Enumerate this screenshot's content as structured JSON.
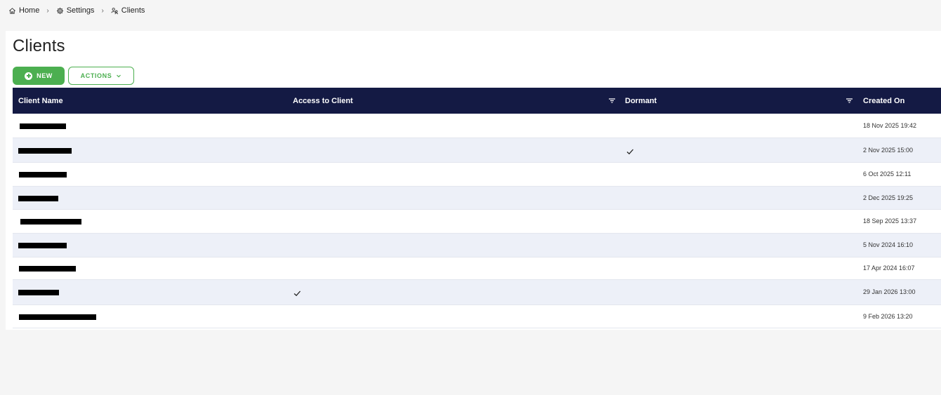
{
  "breadcrumb": {
    "items": [
      {
        "label": "Home",
        "icon": "home-icon"
      },
      {
        "label": "Settings",
        "icon": "gear-icon"
      },
      {
        "label": "Clients",
        "icon": "users-icon"
      }
    ],
    "separator": "›"
  },
  "page": {
    "title": "Clients"
  },
  "toolbar": {
    "new_label": "NEW",
    "new_icon": "plus-circle-icon",
    "actions_label": "ACTIONS",
    "actions_icon": "chevron-down-icon"
  },
  "colors": {
    "accent_green": "#4caf50",
    "header_navy": "#141a44",
    "alt_row": "#edf0f8"
  },
  "table": {
    "columns": [
      "Client Name",
      "Access to Client",
      "Dormant",
      "Created On"
    ],
    "rows": [
      {
        "client_name": "[redacted]",
        "access": false,
        "dormant": false,
        "created_on": "18 Nov 2025 19:42"
      },
      {
        "client_name": "[redacted]",
        "access": false,
        "dormant": true,
        "created_on": "2 Nov 2025 15:00"
      },
      {
        "client_name": "[redacted]",
        "access": false,
        "dormant": false,
        "created_on": "6 Oct 2025 12:11"
      },
      {
        "client_name": "[redacted]",
        "access": false,
        "dormant": false,
        "created_on": "2 Dec 2025 19:25"
      },
      {
        "client_name": "[redacted]",
        "access": false,
        "dormant": false,
        "created_on": "18 Sep 2025 13:37"
      },
      {
        "client_name": "[redacted]",
        "access": false,
        "dormant": false,
        "created_on": "5 Nov 2024 16:10"
      },
      {
        "client_name": "[redacted]",
        "access": false,
        "dormant": false,
        "created_on": "17 Apr 2024 16:07"
      },
      {
        "client_name": "[redacted]",
        "access": true,
        "dormant": false,
        "created_on": "29 Jan 2026 13:00"
      },
      {
        "client_name": "[redacted]",
        "access": false,
        "dormant": false,
        "created_on": "9 Feb 2026 13:20"
      }
    ]
  }
}
